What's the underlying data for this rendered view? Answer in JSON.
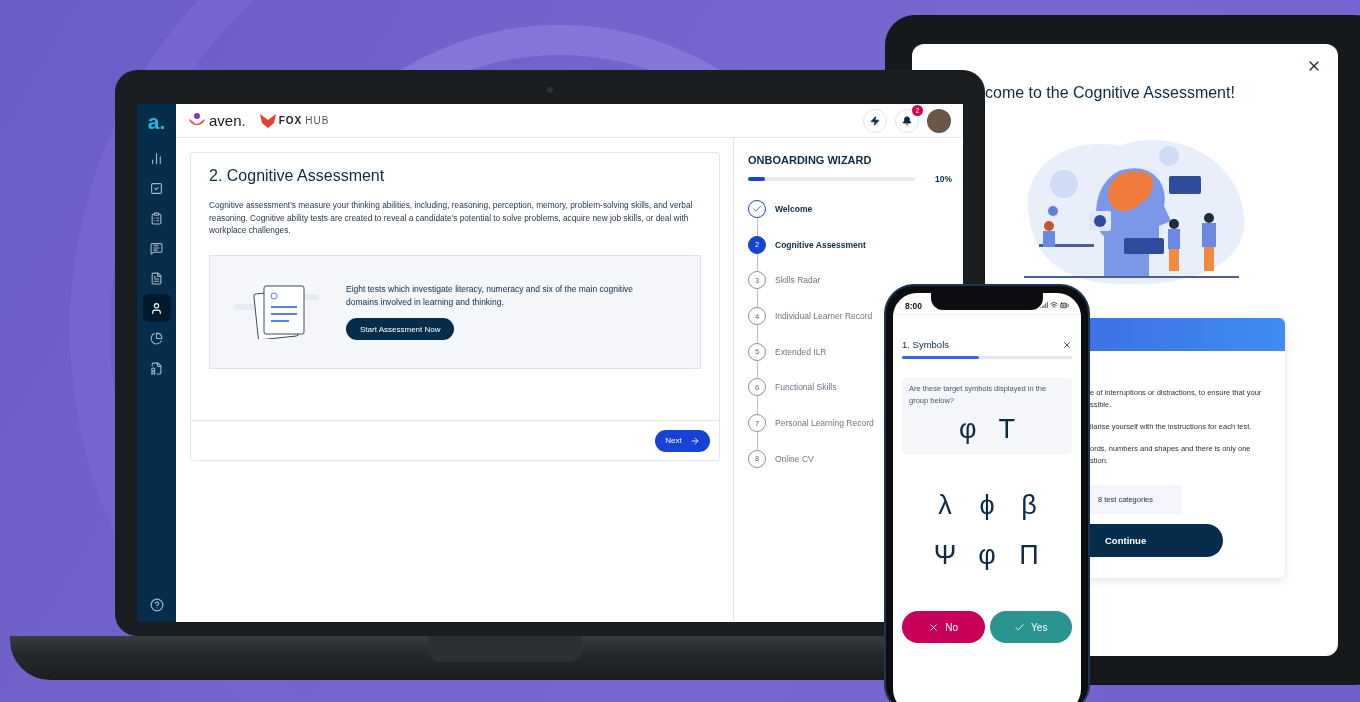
{
  "laptop": {
    "sidebar": {
      "logo": "a.",
      "items": [
        {
          "selected": false
        },
        {
          "selected": false
        },
        {
          "selected": false
        },
        {
          "selected": false
        },
        {
          "selected": false
        },
        {
          "selected": true
        },
        {
          "selected": false
        },
        {
          "selected": false
        }
      ]
    },
    "header": {
      "brand": "aven.",
      "partner_bold": "FOX",
      "partner_light": "HUB",
      "notification_count": "2"
    },
    "card": {
      "title": "2. Cognitive Assessment",
      "description": "Cognitive assessment's measure your thinking abilities, including, reasoning, perception, memory, problem-solving skills, and verbal reasoning. Cognitive ability tests are created to reveal a candidate's potential to solve problems, acquire new job skills, or deal with workplace challenges.",
      "info": "Eight tests which investigate literacy, numeracy and six of the main cognitive domains involved in learning and thinking.",
      "start_button": "Start Assessment Now",
      "next_button": "Next"
    },
    "wizard": {
      "title": "ONBOARDING WIZARD",
      "level": 0.1,
      "percent": "10%",
      "steps": [
        {
          "kind": "done",
          "label": "Welcome"
        },
        {
          "kind": "current",
          "number": "2",
          "label": "Cognitive Assessment"
        },
        {
          "kind": "pending",
          "number": "3",
          "label": "Skills Radar"
        },
        {
          "kind": "pending",
          "number": "4",
          "label": "Individual Learner Record"
        },
        {
          "kind": "pending",
          "number": "5",
          "label": "Extended ILR"
        },
        {
          "kind": "pending",
          "number": "6",
          "label": "Functional Skills"
        },
        {
          "kind": "pending",
          "number": "7",
          "label": "Personal Learning Record"
        },
        {
          "kind": "pending",
          "number": "8",
          "label": "Online CV"
        }
      ]
    }
  },
  "tablet": {
    "title": "come to the Cognitive Assessment!",
    "instructions": [
      [
        "e of interruptions or distractions, to ensure that your",
        "ssible."
      ],
      [
        "liarise yourself with the instructions for each test."
      ],
      [
        "ords, numbers and shapes and there is only one",
        "stion."
      ]
    ],
    "chip": "8 test categories",
    "continue_button": "Continue"
  },
  "phone": {
    "time": "8:00",
    "title": "1. Symbols",
    "level": 0.45,
    "question": "Are these target symbols displayed in the group below?",
    "targets": [
      "φ",
      "Τ"
    ],
    "symbols": [
      "λ",
      "ϕ",
      "β",
      "Ψ",
      "φ",
      "Π"
    ],
    "no_button": "No",
    "yes_button": "Yes"
  }
}
